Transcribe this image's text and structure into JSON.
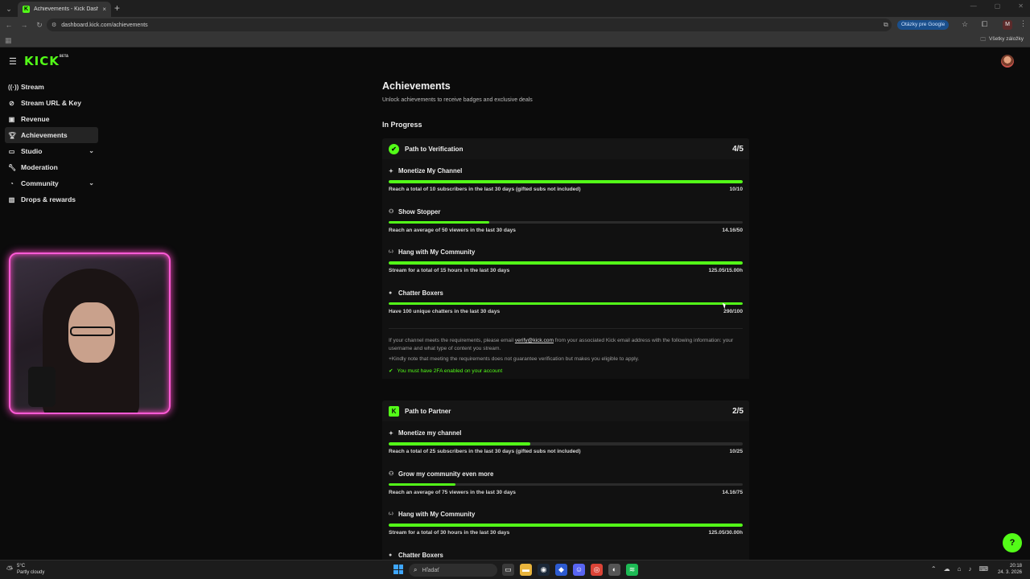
{
  "browser": {
    "tab_title": "Achievements - Kick Dashboard",
    "url": "dashboard.kick.com/achievements",
    "ask_google_label": "Otázky pre Google",
    "profile_initial": "M",
    "all_bookmarks": "Všetky záložky"
  },
  "app": {
    "logo": "KICK",
    "logo_tag": "BETA"
  },
  "sidebar": {
    "items": [
      {
        "label": "Stream",
        "icon": "stream-icon"
      },
      {
        "label": "Stream URL & Key",
        "icon": "link-icon"
      },
      {
        "label": "Revenue",
        "icon": "revenue-icon"
      },
      {
        "label": "Achievements",
        "icon": "trophy-icon"
      },
      {
        "label": "Studio",
        "icon": "studio-icon"
      },
      {
        "label": "Moderation",
        "icon": "wrench-icon"
      },
      {
        "label": "Community",
        "icon": "community-icon"
      },
      {
        "label": "Drops & rewards",
        "icon": "gift-icon"
      }
    ]
  },
  "page": {
    "title": "Achievements",
    "subtitle": "Unlock achievements to receive badges and exclusive deals",
    "section": "In Progress"
  },
  "verification": {
    "title": "Path to Verification",
    "count": "4/5",
    "items": [
      {
        "title": "Monetize My Channel",
        "desc": "Reach a total of 10 subscribers in the last 30 days (gifted subs not included)",
        "value": "10/10",
        "progress": 1.0
      },
      {
        "title": "Show Stopper",
        "desc": "Reach an average of 50 viewers in the last 30 days",
        "value": "14.16/50",
        "progress": 0.283
      },
      {
        "title": "Hang with My Community",
        "desc": "Stream for a total of 15 hours in the last 30 days",
        "value": "125.05/15.00h",
        "progress": 1.0
      },
      {
        "title": "Chatter Boxers",
        "desc": "Have 100 unique chatters in the last 30 days",
        "value": "290/100",
        "progress": 1.0
      }
    ],
    "note_before": "If your channel meets the requirements, please email ",
    "note_email": "verify@kick.com",
    "note_after": " from your associated Kick email address with the following information: your username and what type of content you stream.",
    "note2": "+Kindly note that meeting the requirements does not guarantee verification but makes you eligible to apply.",
    "twofa": "You must have 2FA enabled on your account"
  },
  "partner": {
    "title": "Path to Partner",
    "count": "2/5",
    "items": [
      {
        "title": "Monetize my channel",
        "desc": "Reach a total of 25 subscribers in the last 30 days (gifted subs not included)",
        "value": "10/25",
        "progress": 0.4
      },
      {
        "title": "Grow my community even more",
        "desc": "Reach an average of 75 viewers in the last 30 days",
        "value": "14.16/75",
        "progress": 0.189
      },
      {
        "title": "Hang with My Community",
        "desc": "Stream for a total of 30 hours in the last 30 days",
        "value": "125.05/30.00h",
        "progress": 1.0
      }
    ],
    "next_item_partial": "Chatter Boxers"
  },
  "taskbar": {
    "temp": "5°C",
    "weather": "Partly cloudy",
    "search_placeholder": "Hľadať",
    "time": "20:18",
    "date": "24. 3. 2026"
  },
  "colors": {
    "accent": "#53fc18",
    "background": "#0b0b0b",
    "card": "#151515",
    "cam_border": "#ff5ad6"
  }
}
